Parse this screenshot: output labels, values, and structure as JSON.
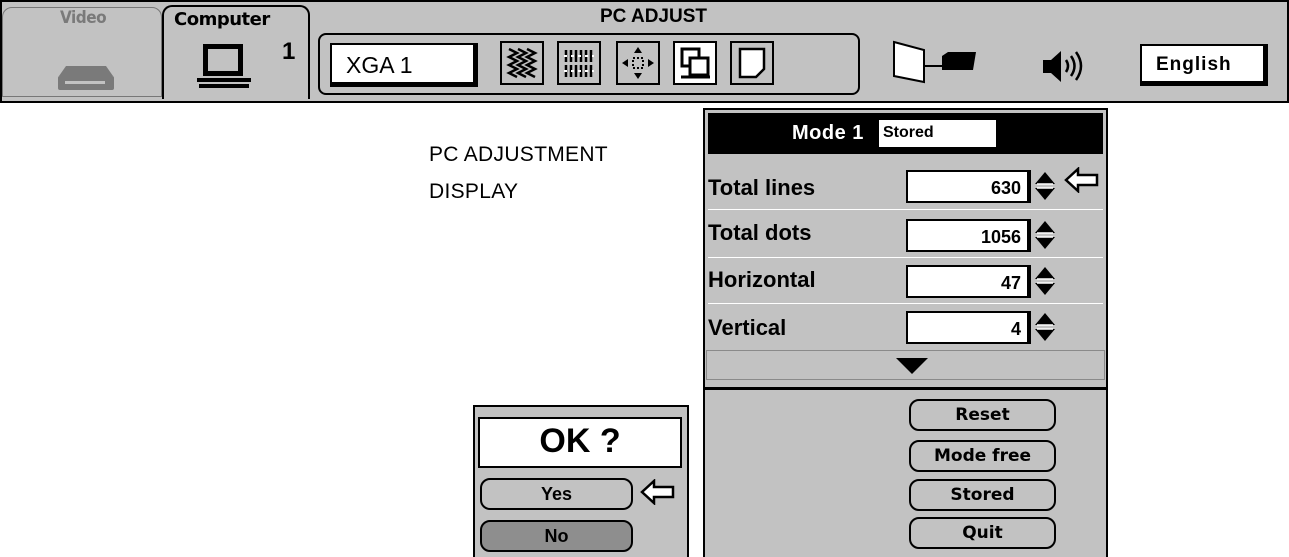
{
  "menubar": {
    "tabs": [
      {
        "label": "Video",
        "icon": "vcr-icon",
        "active": false
      },
      {
        "label": "Computer",
        "icon": "computer-icon",
        "active": true,
        "number": "1"
      }
    ],
    "title": "PC ADJUST",
    "input_mode": "XGA 1",
    "tool_icons": [
      "sync-icon",
      "total-dots-icon",
      "position-icon",
      "pc-adjust-icon",
      "screen-icon"
    ],
    "selected_tool": "pc-adjust-icon",
    "right_icons": [
      "projector-icon",
      "speaker-icon"
    ],
    "language": "English"
  },
  "captions": {
    "line1": "PC ADJUSTMENT",
    "line2": "DISPLAY"
  },
  "panel": {
    "mode_label": "Mode",
    "mode_number": "1",
    "mode_status": "Stored",
    "rows": [
      {
        "label": "Total lines",
        "value": "630",
        "pointer": true
      },
      {
        "label": "Total dots",
        "value": "1056",
        "pointer": false
      },
      {
        "label": "Horizontal",
        "value": "47",
        "pointer": false
      },
      {
        "label": "Vertical",
        "value": "4",
        "pointer": false
      }
    ],
    "buttons": [
      "Reset",
      "Mode free",
      "Stored",
      "Quit"
    ]
  },
  "dialog": {
    "title": "OK ?",
    "yes": "Yes",
    "no": "No"
  },
  "colors": {
    "menu_gray": "#c2c2c2",
    "dark_gray": "#8e8e8e",
    "header_black": "#000000"
  }
}
